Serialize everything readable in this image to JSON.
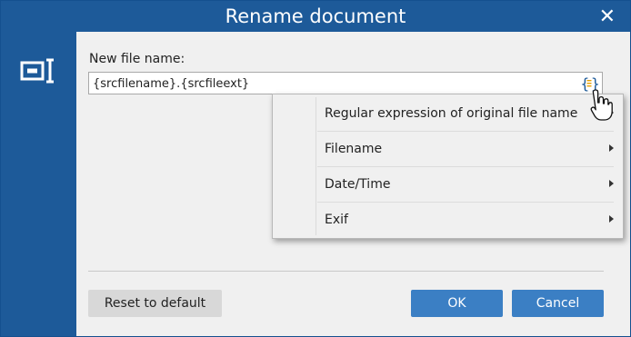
{
  "dialog": {
    "title": "Rename document",
    "close_glyph": "✕"
  },
  "form": {
    "label": "New file name:",
    "value": "{srcfilename}.{srcfileext}",
    "placeholder_icon": "insert-placeholder-icon"
  },
  "menu": {
    "items": [
      {
        "label": "Regular expression of original file name"
      },
      {
        "label": "Filename"
      },
      {
        "label": "Date/Time"
      },
      {
        "label": "Exif"
      }
    ]
  },
  "buttons": {
    "reset": "Reset to default",
    "ok": "OK",
    "cancel": "Cancel"
  },
  "colors": {
    "accent": "#1d5a99",
    "button_blue": "#3b7fc4",
    "placeholder_icon": "#e8a000"
  }
}
